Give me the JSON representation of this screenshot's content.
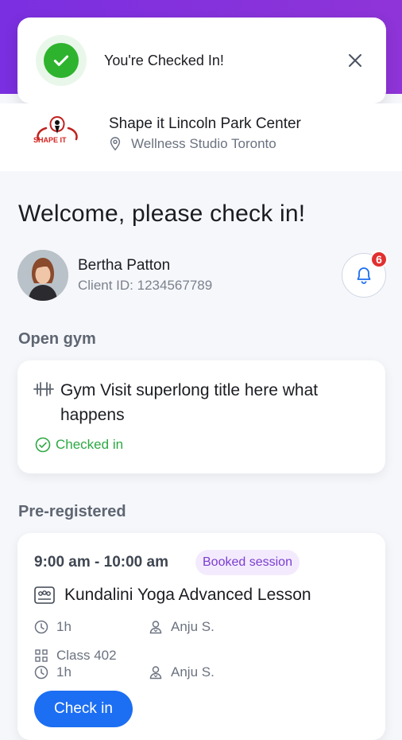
{
  "toast": {
    "message": "You're Checked In!",
    "close_icon": "close-icon",
    "status_icon": "check-circle-icon"
  },
  "header": {
    "gym_name": "Shape it Lincoln Park Center",
    "location": "Wellness Studio Toronto",
    "logo_text": "SHAPE IT"
  },
  "welcome": "Welcome, please check in!",
  "client": {
    "name": "Bertha Patton",
    "id": "Client ID: 1234567789",
    "notifications": "6"
  },
  "open_gym": {
    "section_title": "Open gym",
    "title": "Gym Visit superlong title here what happens",
    "status": "Checked in"
  },
  "preregistered": {
    "section_title": "Pre-registered",
    "time": "9:00 am - 10:00 am",
    "badge": "Booked session",
    "class_title": "Kundalini Yoga Advanced Lesson",
    "duration1": "1h",
    "instructor1": "Anju S.",
    "room": "Class 402",
    "duration2": "1h",
    "instructor2": "Anju S.",
    "checkin_label": "Check in"
  },
  "colors": {
    "accent": "#7a2fe0",
    "success": "#2eb32e",
    "primary_button": "#1c6ef2",
    "badge": "#e1302f"
  }
}
